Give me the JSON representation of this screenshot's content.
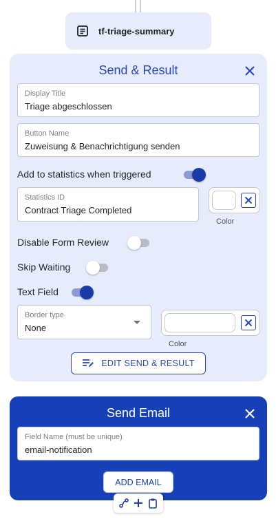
{
  "node_chip": {
    "label": "tf-triage-summary",
    "icon": "document-icon"
  },
  "send_result": {
    "title": "Send & Result",
    "display_title": {
      "label": "Display Title",
      "value": "Triage abgeschlossen"
    },
    "button_name": {
      "label": "Button Name",
      "value": "Zuweisung & Benachrichtigung senden"
    },
    "add_to_statistics": {
      "label": "Add to statistics when triggered",
      "enabled": true
    },
    "statistics_id": {
      "label": "Statistics ID",
      "value": "Contract Triage Completed"
    },
    "stats_color": {
      "caption": "Color"
    },
    "disable_form_review": {
      "label": "Disable Form Review",
      "enabled": false
    },
    "skip_waiting": {
      "label": "Skip Waiting",
      "enabled": false
    },
    "text_field": {
      "label": "Text Field",
      "enabled": true
    },
    "border_type": {
      "label": "Border type",
      "value": "None"
    },
    "text_color": {
      "caption": "Color"
    },
    "edit_button": {
      "label": "EDIT SEND & RESULT"
    }
  },
  "send_email": {
    "title": "Send Email",
    "field_name": {
      "label": "Field Name (must be unique)",
      "value": "email-notification"
    },
    "add_button": {
      "label": "ADD EMAIL"
    }
  },
  "toolbar": {
    "icons": [
      "connect-icon",
      "plus-icon",
      "clipboard-icon"
    ]
  },
  "colors": {
    "accent": "#2a46c8",
    "email_panel": "#1740b8",
    "panel_bg": "#e6ecfb",
    "toggle_knob_on": "#1a3aa8"
  }
}
